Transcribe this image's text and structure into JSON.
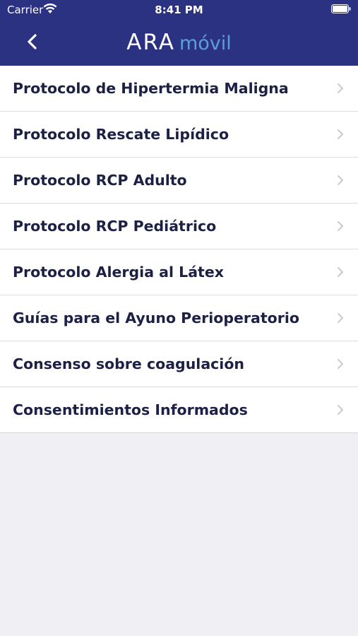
{
  "status_bar": {
    "carrier": "Carrier",
    "time": "8:41 PM"
  },
  "header": {
    "logo_primary": "ARA",
    "logo_secondary": "móvil",
    "back_icon": "chevron-left-icon"
  },
  "colors": {
    "header_bg": "#2c3282",
    "logo_accent": "#5b9fd8",
    "row_text": "#1c2045",
    "page_bg": "#efeff4"
  },
  "list": {
    "items": [
      {
        "label": "Protocolo de Hipertermia Maligna"
      },
      {
        "label": "Protocolo Rescate Lipídico"
      },
      {
        "label": "Protocolo RCP Adulto"
      },
      {
        "label": "Protocolo RCP Pediátrico"
      },
      {
        "label": "Protocolo Alergia al Látex"
      },
      {
        "label": "Guías para el Ayuno Perioperatorio"
      },
      {
        "label": "Consenso sobre coagulación"
      },
      {
        "label": "Consentimientos Informados"
      }
    ]
  }
}
